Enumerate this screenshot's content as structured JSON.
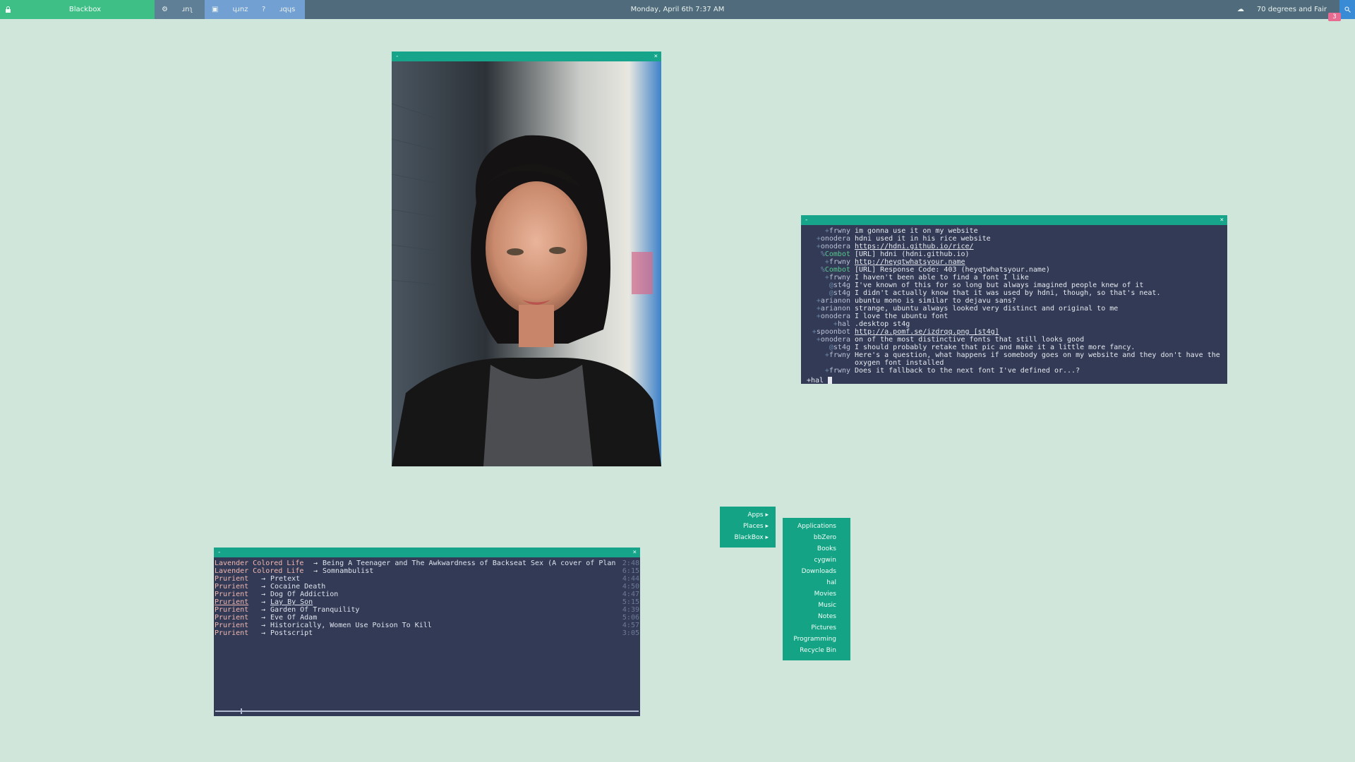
{
  "topbar": {
    "title": "Blackbox",
    "workspaces": [
      {
        "icon": "gear-icon",
        "label": "ɹnʅ"
      },
      {
        "icon": "grid-icon",
        "label": "ɥɹnz"
      },
      {
        "icon": "question-icon",
        "label": "ɹqɥs"
      }
    ],
    "clock": "Monday, April 6th 7:37 AM",
    "weather": "70 degrees and Fair",
    "notification_count": "3",
    "colors": {
      "bar": "#4f6b7c",
      "accent": "#3dbf86",
      "workspace_active": "#73a0d2",
      "badge": "#e86b92"
    }
  },
  "photo_window": {
    "title_left": "-",
    "title_right": "×"
  },
  "chat_window": {
    "title_left": "-",
    "title_right": "×",
    "lines": [
      {
        "pfx": "+",
        "nick": "frwny",
        "msg": "im gonna use it on my website"
      },
      {
        "pfx": "+",
        "nick": "onodera",
        "msg": "hdni used it in his rice website"
      },
      {
        "pfx": "+",
        "nick": "onodera",
        "msg": "https://hdni.github.io/rice/",
        "link": true
      },
      {
        "pfx": "%",
        "nick": "Combot",
        "msg": "[URL] hdni (hdni.github.io)",
        "bot": true
      },
      {
        "pfx": "+",
        "nick": "frwny",
        "msg": "http://heyqtwhatsyour.name",
        "link": true
      },
      {
        "pfx": "%",
        "nick": "Combot",
        "msg": "[URL] Response Code: 403 (heyqtwhatsyour.name)",
        "bot": true
      },
      {
        "pfx": "+",
        "nick": "frwny",
        "msg": "I haven't been able to find a font I like"
      },
      {
        "pfx": "@",
        "nick": "st4g",
        "msg": "I've known of this for so long but always imagined people knew of it"
      },
      {
        "pfx": "@",
        "nick": "st4g",
        "msg": "I didn't actually know that it was used by hdni, though, so that's neat."
      },
      {
        "pfx": "+",
        "nick": "arianon",
        "msg": "ubuntu mono is similar to dejavu sans?"
      },
      {
        "pfx": "+",
        "nick": "arianon",
        "msg": "strange, ubuntu always looked very distinct and original to me"
      },
      {
        "pfx": "+",
        "nick": "onodera",
        "msg": "I love the ubuntu font"
      },
      {
        "pfx": "+",
        "nick": "hal",
        "msg": ".desktop st4g"
      },
      {
        "pfx": "+",
        "nick": "spoonbot",
        "msg": "http://a.pomf.se/izdrqq.png [st4g]",
        "link": true
      },
      {
        "pfx": "+",
        "nick": "onodera",
        "msg": "on of the most distinctive fonts that still looks good"
      },
      {
        "pfx": "@",
        "nick": "st4g",
        "msg": "I should probably retake that pic and make it a little more fancy."
      },
      {
        "pfx": "+",
        "nick": "frwny",
        "msg": "Here's a question, what happens if somebody goes on my website and they don't have the oxygen font installed"
      },
      {
        "pfx": "+",
        "nick": "frwny",
        "msg": "Does it fallback to the next font I've defined or...?"
      }
    ],
    "input_prompt": "+hal"
  },
  "music_window": {
    "title_left": "-",
    "title_right": "×",
    "tracks": [
      {
        "artist": "Lavender Colored Life",
        "title": "Being A Teenager and The Awkwardness of Backseat Sex (A cover of Plan",
        "duration": "2:48"
      },
      {
        "artist": "Lavender Colored Life",
        "title": "Somnambulist",
        "duration": "6:15"
      },
      {
        "artist": "Prurient",
        "title": "Pretext",
        "duration": "4:44"
      },
      {
        "artist": "Prurient",
        "title": "Cocaine Death",
        "duration": "4:50"
      },
      {
        "artist": "Prurient",
        "title": "Dog Of Addiction",
        "duration": "4:47"
      },
      {
        "artist": "Prurient",
        "title": "Lay By Son",
        "duration": "5:15",
        "current": true
      },
      {
        "artist": "Prurient",
        "title": "Garden Of Tranquility",
        "duration": "4:39"
      },
      {
        "artist": "Prurient",
        "title": "Eve Of Adam",
        "duration": "5:06"
      },
      {
        "artist": "Prurient",
        "title": "Historically, Women Use Poison To Kill",
        "duration": "4:57"
      },
      {
        "artist": "Prurient",
        "title": "Postscript",
        "duration": "3:05"
      }
    ],
    "arrow": "→",
    "progress": 0.06
  },
  "root_menu": {
    "items": [
      "Apps ▸",
      "Places ▸",
      "BlackBox ▸"
    ]
  },
  "places_menu": {
    "items": [
      "Applications",
      "bbZero",
      "Books",
      "cygwin",
      "Downloads",
      "hal",
      "Movies",
      "Music",
      "Notes",
      "Pictures",
      "Programming",
      "Recycle Bin"
    ]
  }
}
